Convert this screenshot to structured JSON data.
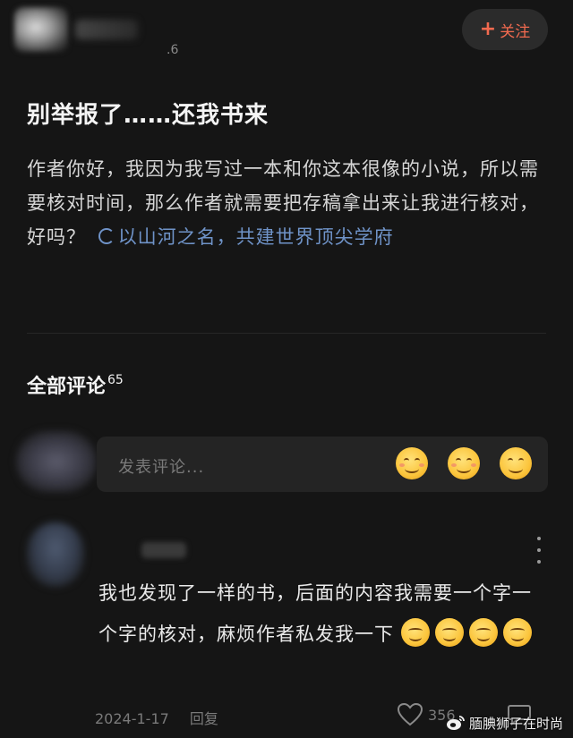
{
  "post": {
    "meta": ".6",
    "follow_label": "关注",
    "title": "别举报了……还我书来",
    "content": "作者你好，我因为我写过一本和你这本很像的小说，所以需要核对时间，那么作者就需要把存稿拿出来让我进行核对，好吗？",
    "topic": "以山河之名，共建世界顶尖学府"
  },
  "comments_section": {
    "title": "全部评论",
    "count": "65",
    "input_placeholder": "发表评论..."
  },
  "comment": {
    "text": "我也发现了一样的书，后面的内容我需要一个字一个字的核对，麻烦作者私发我一下",
    "date": "2024-1-17",
    "reply_label": "回复",
    "likes": "356"
  },
  "watermark": {
    "text": "腼腆狮子在时尚"
  },
  "colors": {
    "background": "#151515",
    "accent": "#f26a4f",
    "link": "#6f93c8"
  }
}
